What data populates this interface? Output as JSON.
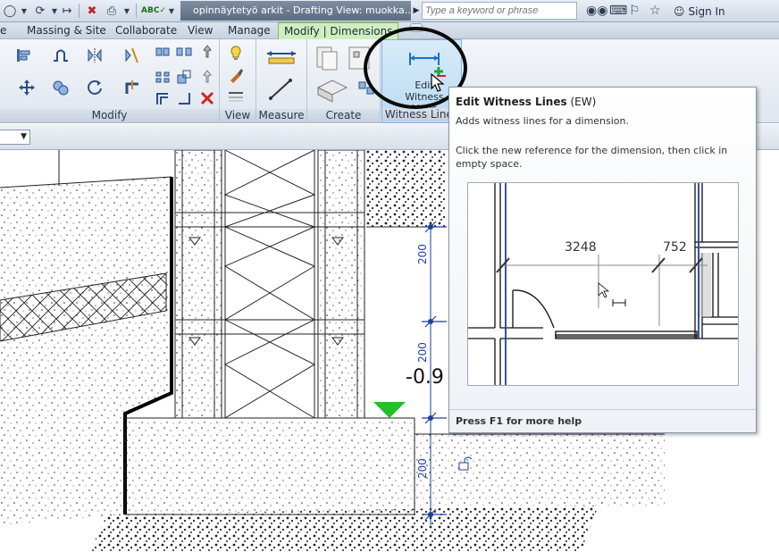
{
  "titlebar": {
    "document_title": "opinnäytetyö arkit - Drafting View: muokka...",
    "search_placeholder": "Type a keyword or phrase",
    "sign_in": "Sign In"
  },
  "tabs": [
    {
      "label": "e"
    },
    {
      "label": "Massing & Site"
    },
    {
      "label": "Collaborate"
    },
    {
      "label": "View"
    },
    {
      "label": "Manage"
    },
    {
      "label": "Modify | Dimensions",
      "active": true
    }
  ],
  "ribbon": {
    "panels": {
      "modify": "Modify",
      "view": "View",
      "measure": "Measure",
      "create": "Create",
      "witness": "Witness Lines"
    },
    "witness_button": {
      "line1": "Edit",
      "line2": "Witness Lines"
    }
  },
  "tooltip": {
    "title": "Edit Witness Lines",
    "shortcut": "(EW)",
    "description": "Adds witness lines for a dimension.",
    "hint": "Click the new reference for the dimension, then click in empty space.",
    "preview_dims": [
      "3248",
      "752"
    ],
    "help": "Press F1 for more help"
  },
  "canvas": {
    "elevation_text": "-0.9",
    "dimension_labels": [
      "200",
      "200",
      "200"
    ]
  },
  "colors": {
    "active_tab": "#cfeec0",
    "witness_panel": "#b9dbf3",
    "elevation_marker": "#22c02a",
    "dimension_line": "#1f3f9a"
  }
}
